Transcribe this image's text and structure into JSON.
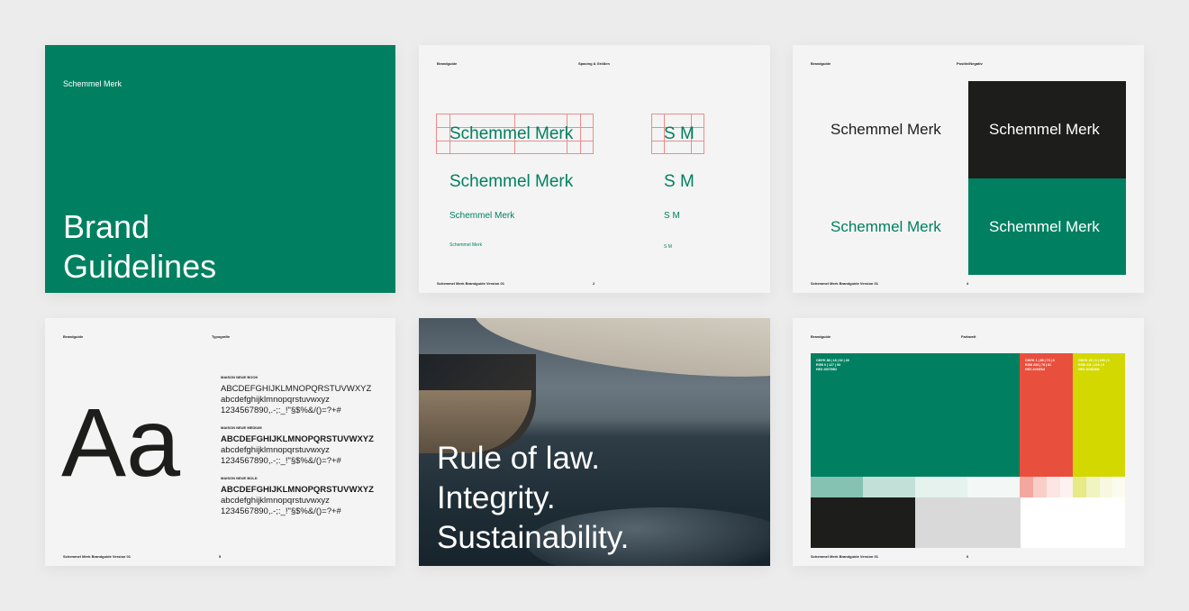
{
  "colors": {
    "green": "#008060",
    "red": "#e94f3d",
    "lime": "#d3d800",
    "black": "#1d1d1b",
    "gray": "#d9d9d9",
    "white": "#ffffff"
  },
  "cover": {
    "brand_name": "Schemmel Merk",
    "title_line1": "Brand",
    "title_line2": "Guidelines"
  },
  "spacing": {
    "header_left": "Brandguide",
    "header_right": "Spacing & Größen",
    "wordmark": "Schemmel Merk",
    "monogram": "S M",
    "footer_left": "Schemmel Merk Brandguide Version 01",
    "page_number": "2"
  },
  "positive": {
    "header_left": "Brandguide",
    "header_right": "Positiv/Negativ",
    "wordmark": "Schemmel Merk",
    "footer_left": "Schemmel Merk Brandguide Version 01",
    "page_number": "4"
  },
  "typography": {
    "header_left": "Brandguide",
    "header_right": "Typografie",
    "sample": "Aa",
    "styles": [
      {
        "name": "MAISON NEUE BOOK",
        "upper": "ABCDEFGHIJKLMNOPQRSTUVWXYZ",
        "lower": "abcdefghijklmnopqrstuvwxyz",
        "digits": "1234567890,.-;:_!\"§$%&/()=?+#"
      },
      {
        "name": "MAISON NEUE MEDIUM",
        "upper": "ABCDEFGHIJKLMNOPQRSTUVWXYZ",
        "lower": "abcdefghijklmnopqrstuvwxyz",
        "digits": "1234567890,.-;:_!\"§$%&/()=?+#"
      },
      {
        "name": "MAISON NEUE BOLD",
        "upper": "ABCDEFGHIJKLMNOPQRSTUVWXYZ",
        "lower": "abcdefghijklmnopqrstuvwxyz",
        "digits": "1234567890,.-;:_!\"§$%&/()=?+#"
      }
    ],
    "footer_left": "Schemmel Merk Brandguide Version 01",
    "page_number": "5"
  },
  "values_slide": {
    "line1": "Rule of law.",
    "line2": "Integrity.",
    "line3": "Sustainability."
  },
  "colorpalette": {
    "header_left": "Brandguide",
    "header_right": "Farbwelt",
    "green_spec": [
      "CMYK 88 | 18 | 62 | 28",
      "RGB 0 | 127 | 93",
      "HEX #00795D"
    ],
    "red_spec": [
      "CMYK 1 | 85 | 73 | 0",
      "RGB 233 | 79 | 61",
      "HEX #e94f3d"
    ],
    "lime_spec": [
      "CMYK 25 | 0 | 100 | 0",
      "RGB 211 | 216 | 0",
      "HEX #D3D800"
    ],
    "footer_left": "Schemmel Merk Brandguide Version 01",
    "page_number": "6"
  }
}
